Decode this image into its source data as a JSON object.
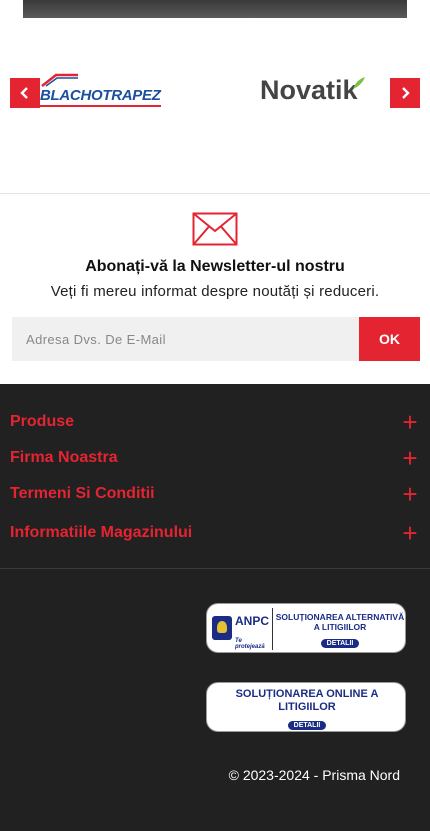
{
  "carousel": {
    "brands": [
      {
        "name": "BLACHOTRAPEZ"
      },
      {
        "name": "Novatik"
      }
    ],
    "prev_icon": "chevron-left-icon",
    "next_icon": "chevron-right-icon"
  },
  "newsletter": {
    "icon": "envelope-icon",
    "title": "Abonați-vă la Newsletter-ul nostru",
    "subtitle": "Veți fi mereu informat despre noutăți și reduceri.",
    "placeholder": "Adresa Dvs. De E-Mail",
    "button_label": "OK"
  },
  "footer": {
    "sections": [
      {
        "label": "Produse",
        "icon": "plus-icon"
      },
      {
        "label": "Firma Noastra",
        "icon": "plus-icon"
      },
      {
        "label": "Termeni Si Conditii",
        "icon": "plus-icon"
      },
      {
        "label": "Informatiile Magazinului",
        "icon": "plus-icon"
      }
    ],
    "badges": {
      "sal": {
        "org": "ANPC",
        "tagline": "Te protejează",
        "title": "SOLUȚIONAREA ALTERNATIVĂ A LITIGIILOR",
        "button": "DETALII"
      },
      "sol": {
        "title": "SOLUȚIONAREA ONLINE A LITIGIILOR",
        "button": "DETALII"
      }
    },
    "copyright": "© 2023-2024 - Prisma Nord"
  },
  "colors": {
    "accent": "#e52432",
    "footer_bg": "#212121",
    "badge_blue": "#1b2c86"
  }
}
